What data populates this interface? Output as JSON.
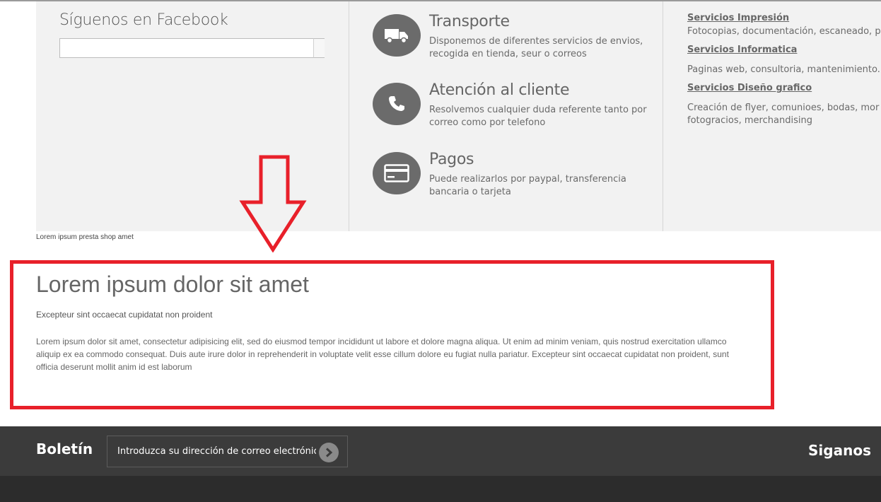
{
  "facebook": {
    "title": "Síguenos en Facebook"
  },
  "services": [
    {
      "icon": "truck-icon",
      "title": "Transporte",
      "lines": [
        "Disponemos de diferentes servicios de envios,",
        "recogida en tienda, seur o correos"
      ]
    },
    {
      "icon": "phone-icon",
      "title": "Atención al cliente",
      "lines": [
        "Resolvemos cualquier duda referente tanto por",
        "correo como por telefono"
      ]
    },
    {
      "icon": "credit-card-icon",
      "title": "Pagos",
      "lines": [
        "Puede realizarlos por paypal, transferencia",
        "bancaria o tarjeta"
      ]
    }
  ],
  "links": [
    {
      "title": "Servicios Impresión",
      "lines": [
        "Fotocopias, documentación, escaneado, p"
      ]
    },
    {
      "title": "Servicios Informatica",
      "lines": [
        "Paginas web, consultoria, mantenimiento."
      ]
    },
    {
      "title": "Servicios Diseño grafico",
      "lines": [
        "Creación de flyer, comunioes, bodas, mor",
        "fotogracios, merchandising"
      ]
    }
  ],
  "note": "Lorem ipsum presta shop amet",
  "content": {
    "title": "Lorem ipsum dolor sit amet",
    "subtitle": "Excepteur sint occaecat cupidatat non proident",
    "lines": [
      "Lorem ipsum dolor sit amet, consectetur adipisicing elit, sed do eiusmod tempor incididunt ut labore et dolore magna aliqua. Ut enim ad minim veniam, quis nostrud exercitation ullamco",
      "aliquip ex ea commodo consequat. Duis aute irure dolor in reprehenderit in voluptate velit esse cillum dolore eu fugiat nulla pariatur. Excepteur sint occaecat cupidatat non proident, sunt",
      "officia deserunt mollit anim id est laborum"
    ]
  },
  "footer": {
    "newsletter_label": "Boletín",
    "newsletter_placeholder": "Introduzca su dirección de correo electrónico",
    "follow_label": "Siganos"
  },
  "colors": {
    "annotation": "#e8202a",
    "icon_bg": "#6b6b6b",
    "footer_bg": "#3b3b3b"
  }
}
